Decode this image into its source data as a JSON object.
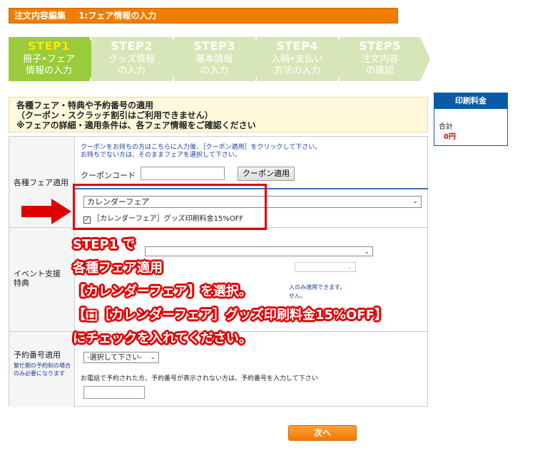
{
  "header": {
    "title": "注文内容編集",
    "subtitle": "1:フェア情報の入力"
  },
  "steps": [
    {
      "num": "STEP1",
      "line1": "冊子•フェア",
      "line2": "情報の入力",
      "active": true
    },
    {
      "num": "STEP2",
      "line1": "グッズ情報",
      "line2": "の入力",
      "active": false
    },
    {
      "num": "STEP3",
      "line1": "基本情報",
      "line2": "の入力",
      "active": false
    },
    {
      "num": "STEP4",
      "line1": "入稿•支払い",
      "line2": "方法の入力",
      "active": false
    },
    {
      "num": "STEP5",
      "line1": "注文内容",
      "line2": "の確認",
      "active": false
    }
  ],
  "notice": {
    "line1": "各種フェア・特典や予約番号の適用",
    "line2": "（クーポン・スクラッチ割引はご利用できません）",
    "line3": "※フェアの詳細・適用条件は、各フェア情報をご確認ください"
  },
  "side_panel": {
    "header": "印刷料金",
    "total_label": "合計",
    "total_value": "0円"
  },
  "fair_section": {
    "label": "各種フェア適用",
    "coupon_help_1": "クーポンをお持ちの方はこちらに入力後、［クーポン適用］をクリックして下さい。",
    "coupon_help_2": "お持ちでない方は、そのままフェアを選択して下さい。",
    "coupon_label": "クーポンコード",
    "coupon_value": "",
    "coupon_button": "クーポン適用",
    "fair_select_value": "カレンダーフェア",
    "checkbox_label": "［カレンダーフェア］グッズ印刷料金15%OFF",
    "checkbox_checked": true
  },
  "event_section": {
    "label_line1": "イベント支援",
    "label_line2": "特典",
    "partial_text_1": "入のみ適用できます。",
    "partial_text_2": "せん。"
  },
  "reservation_section": {
    "label": "予約番号適用",
    "note": "繁忙期の予約制の場合のみ必要になります",
    "select_value": "-選択して下さい-",
    "help": "お電話で予約された方、予約番号が表示されない方は、予約番号を入力して下さい",
    "input_value": ""
  },
  "overlay": {
    "line1": "STEP1 で",
    "line2": "各種フェア適用",
    "line3": "【カレンダーフェア】を選択。",
    "line4": "【□［カレンダーフェア］グッズ印刷料金15%OFF】",
    "line5": "にチェックを入れてください。"
  },
  "next_button": "次へ",
  "colors": {
    "header_orange": "#f07d00",
    "step_active": "#9acb3c",
    "step_inactive": "#d7e6b8",
    "highlight_red": "#e00000",
    "panel_blue": "#0b5aa6"
  }
}
